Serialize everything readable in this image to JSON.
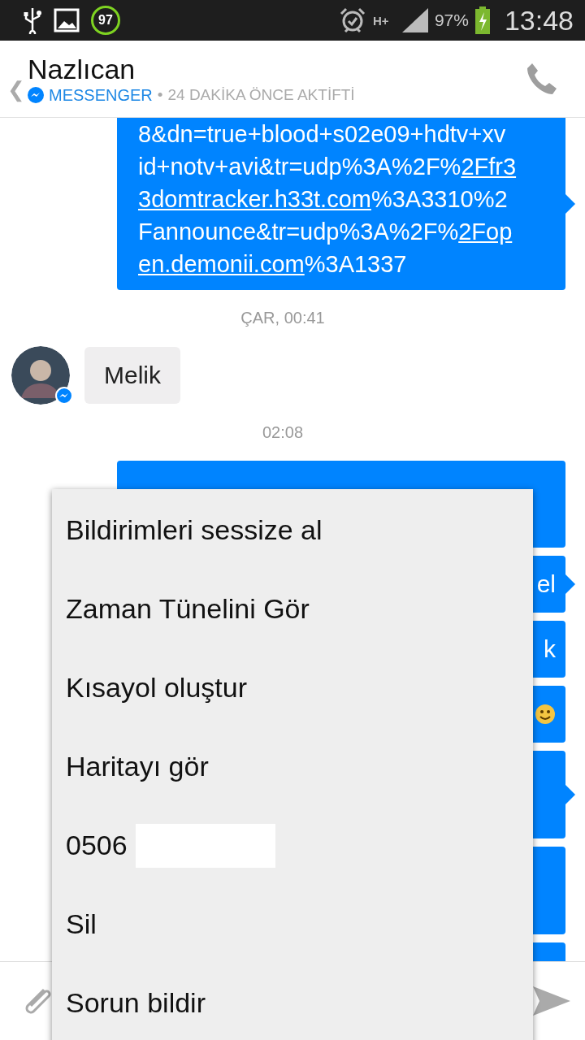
{
  "status_bar": {
    "notification_badge": "97",
    "network": "H+",
    "battery": "97%",
    "time": "13:48"
  },
  "header": {
    "back": "❮",
    "name": "Nazlıcan",
    "source": "MESSENGER",
    "separator": "•",
    "activity": "24 DAKİKA ÖNCE AKTİFTİ"
  },
  "messages": [
    {
      "kind": "outgoing_lines",
      "tail": true,
      "lines": [
        [
          {
            "text": "8&dn=true+blood+s02e09+hdtv+xv",
            "link": false
          }
        ],
        [
          {
            "text": "id+notv+avi&tr=udp%3A%2F%",
            "link": false
          },
          {
            "text": "2Ffr3",
            "link": true
          }
        ],
        [
          {
            "text": "3domtracker.h33t.com",
            "link": true
          },
          {
            "text": "%3A3310%2",
            "link": false
          }
        ],
        [
          {
            "text": "Fannounce&tr=udp%3A%2F%",
            "link": false
          },
          {
            "text": "2Fop",
            "link": true
          }
        ],
        [
          {
            "text": "en.demonii.com",
            "link": true
          },
          {
            "text": "%3A1337",
            "link": false
          }
        ]
      ]
    },
    {
      "kind": "timestamp",
      "text": "ÇAR, 00:41"
    },
    {
      "kind": "incoming",
      "text": "Melik"
    },
    {
      "kind": "timestamp",
      "text": "02:08"
    },
    {
      "kind": "outgoing_covered",
      "tail": false
    },
    {
      "kind": "outgoing",
      "text": "el",
      "tail": true
    },
    {
      "kind": "outgoing",
      "text": "k",
      "tail": false
    },
    {
      "kind": "outgoing_emoji",
      "tail": false
    },
    {
      "kind": "outgoing_hidden",
      "tail": true
    },
    {
      "kind": "outgoing_hidden",
      "tail": false
    },
    {
      "kind": "outgoing_hidden"
    }
  ],
  "menu": {
    "items": [
      {
        "kind": "text",
        "label": "Bildirimleri sessize al"
      },
      {
        "kind": "text",
        "label": "Zaman Tünelini Gör"
      },
      {
        "kind": "text",
        "label": "Kısayol oluştur"
      },
      {
        "kind": "text",
        "label": "Haritayı gör"
      },
      {
        "kind": "redacted",
        "label": "0506"
      },
      {
        "kind": "text",
        "label": "Sil"
      },
      {
        "kind": "text",
        "label": "Sorun bildir"
      }
    ]
  }
}
